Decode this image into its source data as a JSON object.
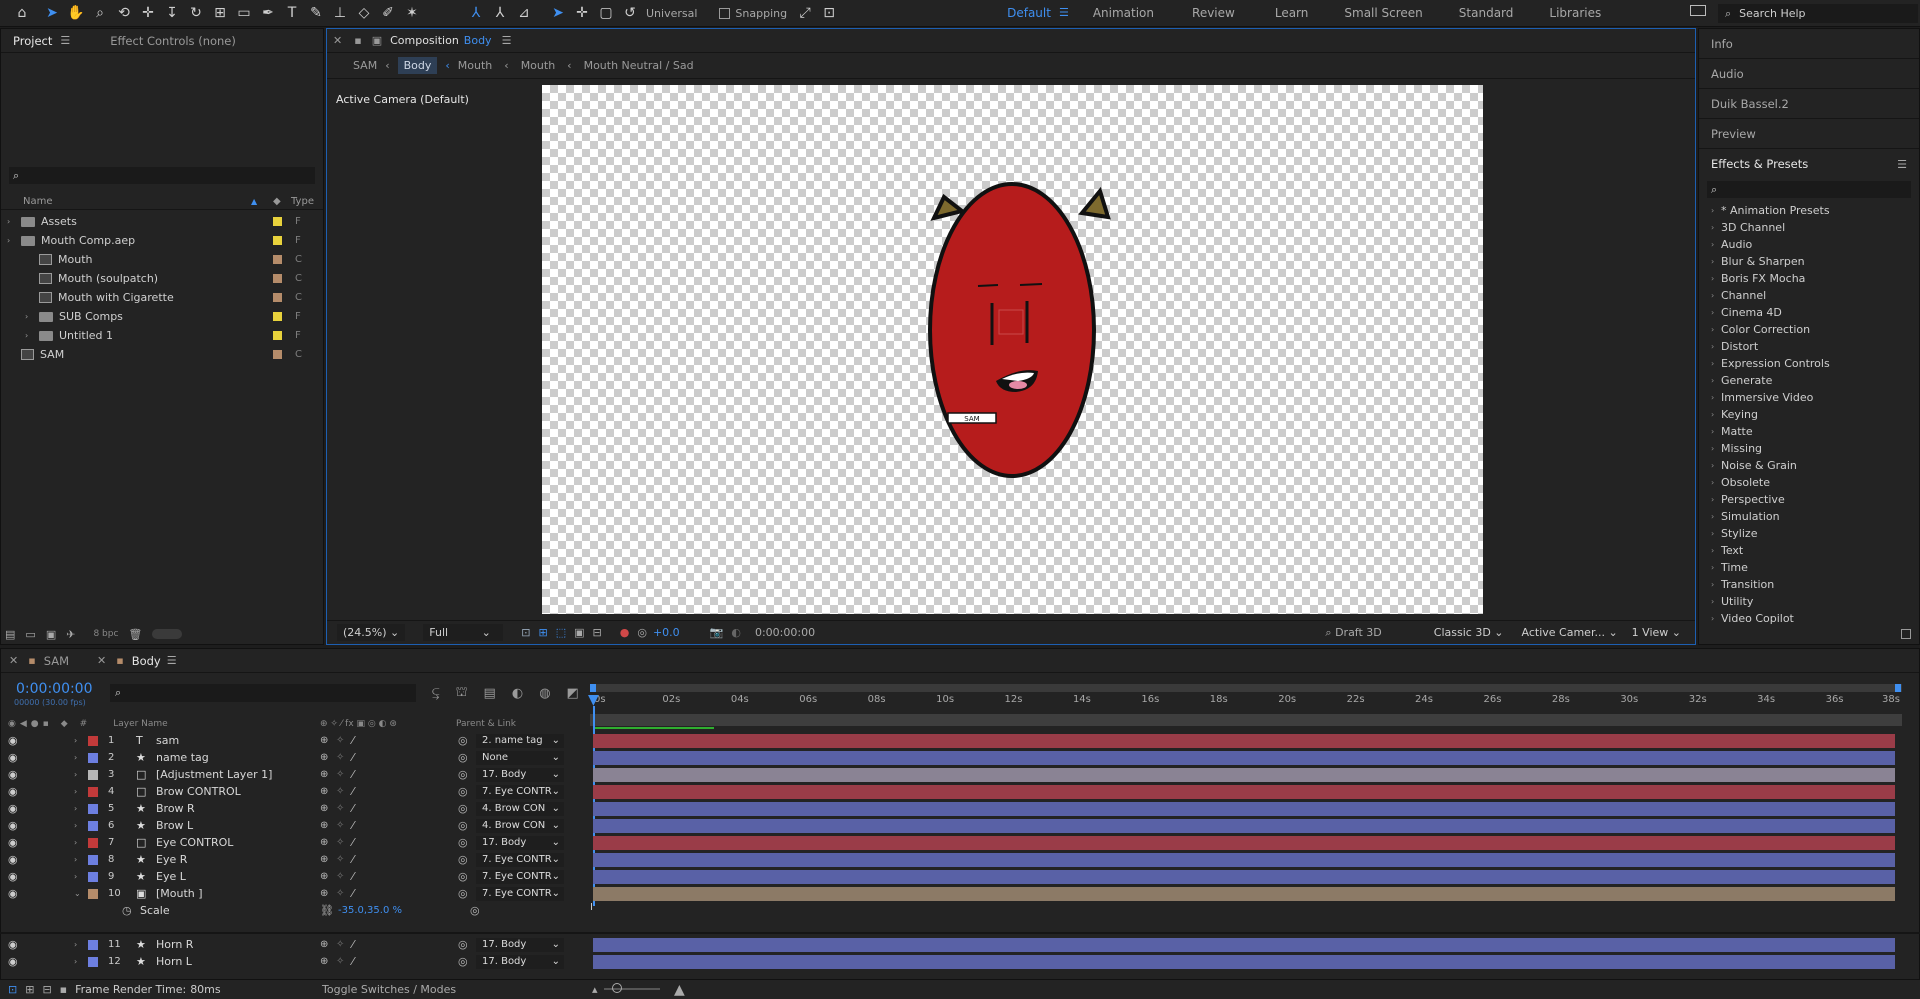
{
  "toolbar": {
    "universal_label": "Universal",
    "snapping_label": "Snapping",
    "workspaces": [
      "Default",
      "Animation",
      "Review",
      "Learn",
      "Small Screen",
      "Standard",
      "Libraries"
    ],
    "search_help": "Search Help"
  },
  "project_panel": {
    "tab_project": "Project",
    "tab_effect_controls": "Effect Controls (none)",
    "col_name": "Name",
    "col_type": "Type",
    "items": [
      {
        "name": "Assets",
        "type": "F",
        "kind": "folder",
        "indent": 0,
        "swatch": "#e8d23c"
      },
      {
        "name": "Mouth Comp.aep",
        "type": "F",
        "kind": "folder",
        "indent": 0,
        "swatch": "#e8d23c"
      },
      {
        "name": "Mouth",
        "type": "C",
        "kind": "comp",
        "indent": 1,
        "swatch": "#b58c6a"
      },
      {
        "name": "Mouth (soulpatch)",
        "type": "C",
        "kind": "comp",
        "indent": 1,
        "swatch": "#b58c6a"
      },
      {
        "name": "Mouth with Cigarette",
        "type": "C",
        "kind": "comp",
        "indent": 1,
        "swatch": "#b58c6a"
      },
      {
        "name": "SUB Comps",
        "type": "F",
        "kind": "folder",
        "indent": 1,
        "swatch": "#e8d23c"
      },
      {
        "name": "Untitled 1",
        "type": "F",
        "kind": "folder",
        "indent": 1,
        "swatch": "#e8d23c"
      },
      {
        "name": "SAM",
        "type": "C",
        "kind": "comp",
        "indent": 0,
        "swatch": "#b58c6a"
      }
    ],
    "bpc": "8 bpc"
  },
  "comp_panel": {
    "title": "Composition",
    "comp_name": "Body",
    "breadcrumbs": [
      "SAM",
      "Body",
      "Mouth",
      "Mouth",
      "Mouth Neutral / Sad"
    ],
    "camera_label": "Active Camera (Default)",
    "name_tag_text": "SAM",
    "zoom": "(24.5%)",
    "resolution": "Full",
    "exposure": "+0.0",
    "timecode": "0:00:00:00",
    "draft3d": "Draft 3D",
    "renderer": "Classic 3D",
    "camera_select": "Active Camer...",
    "view_select": "1 View"
  },
  "right_panel": {
    "items": [
      "Info",
      "Audio",
      "Duik Bassel.2",
      "Preview"
    ],
    "effects_title": "Effects & Presets",
    "categories": [
      "* Animation Presets",
      "3D Channel",
      "Audio",
      "Blur & Sharpen",
      "Boris FX Mocha",
      "Channel",
      "Cinema 4D",
      "Color Correction",
      "Distort",
      "Expression Controls",
      "Generate",
      "Immersive Video",
      "Keying",
      "Matte",
      "Missing",
      "Noise & Grain",
      "Obsolete",
      "Perspective",
      "Simulation",
      "Stylize",
      "Text",
      "Time",
      "Transition",
      "Utility",
      "Video Copilot"
    ]
  },
  "timeline": {
    "tab_sam": "SAM",
    "tab_body": "Body",
    "timecode": "0:00:00:00",
    "frame_info": "00000 (30.00 fps)",
    "col_layer_name": "Layer Name",
    "col_parent": "Parent & Link",
    "ticks": [
      "0s",
      "02s",
      "04s",
      "06s",
      "08s",
      "10s",
      "12s",
      "14s",
      "16s",
      "18s",
      "20s",
      "22s",
      "24s",
      "26s",
      "28s",
      "30s",
      "32s",
      "34s",
      "36s",
      "38s"
    ],
    "layers": [
      {
        "num": "1",
        "name": "sam",
        "icon": "T",
        "swatch": "#c23a3a",
        "parent": "2. name tag",
        "bar": "#9a3c48"
      },
      {
        "num": "2",
        "name": "name tag",
        "icon": "★",
        "swatch": "#6d7fe0",
        "parent": "None",
        "bar": "#5961a6"
      },
      {
        "num": "3",
        "name": "[Adjustment Layer 1]",
        "icon": "□",
        "swatch": "#b6b6b6",
        "parent": "17. Body",
        "bar": "#8a8394"
      },
      {
        "num": "4",
        "name": "Brow CONTROL",
        "icon": "□",
        "swatch": "#c23a3a",
        "parent": "7. Eye CONTR",
        "bar": "#9a3c48"
      },
      {
        "num": "5",
        "name": "Brow R",
        "icon": "★",
        "swatch": "#6d7fe0",
        "parent": "4. Brow CON",
        "bar": "#5961a6"
      },
      {
        "num": "6",
        "name": "Brow L",
        "icon": "★",
        "swatch": "#6d7fe0",
        "parent": "4. Brow CON",
        "bar": "#5961a6"
      },
      {
        "num": "7",
        "name": "Eye CONTROL",
        "icon": "□",
        "swatch": "#c23a3a",
        "parent": "17. Body",
        "bar": "#9a3c48"
      },
      {
        "num": "8",
        "name": "Eye R",
        "icon": "★",
        "swatch": "#6d7fe0",
        "parent": "7. Eye CONTR",
        "bar": "#5961a6"
      },
      {
        "num": "9",
        "name": "Eye L",
        "icon": "★",
        "swatch": "#6d7fe0",
        "parent": "7. Eye CONTR",
        "bar": "#5961a6"
      },
      {
        "num": "10",
        "name": "[Mouth ]",
        "icon": "▣",
        "swatch": "#b58c6a",
        "parent": "7. Eye CONTR",
        "bar": "#8c7a66"
      }
    ],
    "scale_label": "Scale",
    "scale_value": "-35.0,35.0 %",
    "layers_bottom": [
      {
        "num": "11",
        "name": "Horn R",
        "icon": "★",
        "swatch": "#6d7fe0",
        "parent": "17. Body",
        "bar": "#5961a6"
      },
      {
        "num": "12",
        "name": "Horn L",
        "icon": "★",
        "swatch": "#6d7fe0",
        "parent": "17. Body",
        "bar": "#5961a6"
      }
    ],
    "frame_render_label": "Frame Render Time:",
    "frame_render_value": "80ms",
    "toggle_label": "Toggle Switches / Modes"
  }
}
